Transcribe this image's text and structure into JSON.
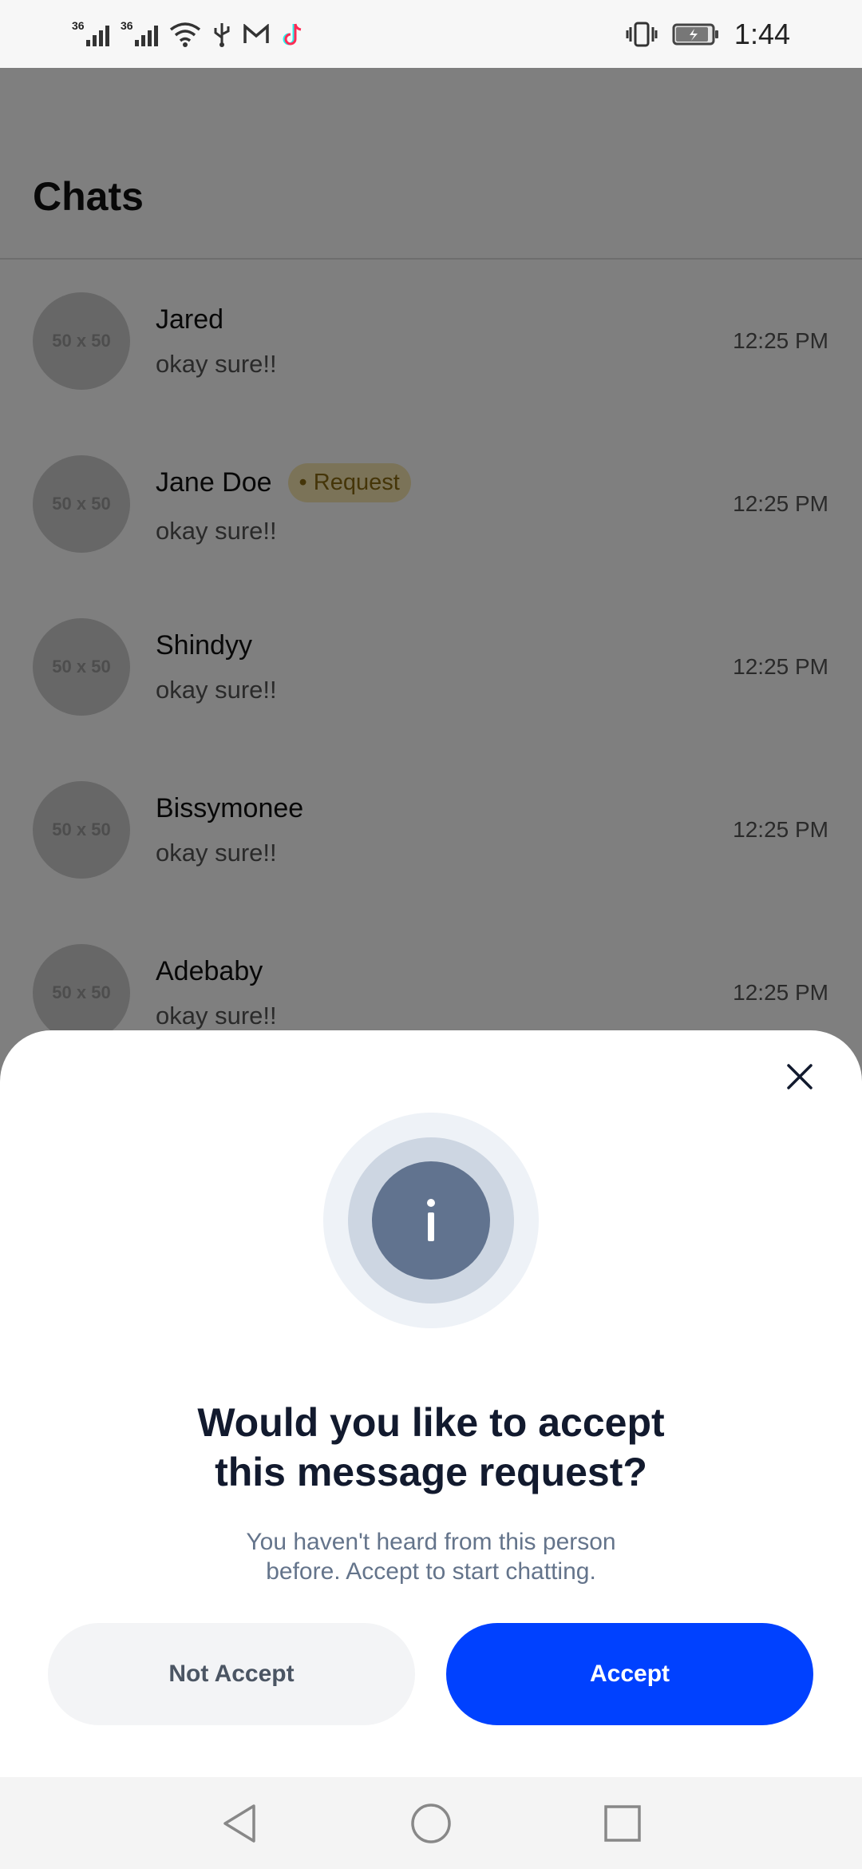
{
  "status_bar": {
    "network1": "36",
    "network2": "36",
    "time": "1:44",
    "icons": [
      "signal-icon",
      "signal-icon",
      "wifi-icon",
      "usb-icon",
      "gmail-icon",
      "tiktok-icon",
      "vibrate-icon",
      "battery-charging-icon"
    ]
  },
  "header": {
    "title": "Chats"
  },
  "chats": [
    {
      "avatar": "50 x 50",
      "name": "Jared",
      "message": "okay sure!!",
      "time": "12:25 PM"
    },
    {
      "avatar": "50 x 50",
      "name": "Jane Doe",
      "badge": "• Request",
      "message": "okay sure!!",
      "time": "12:25 PM"
    },
    {
      "avatar": "50 x 50",
      "name": "Shindyy",
      "message": "okay sure!!",
      "time": "12:25 PM"
    },
    {
      "avatar": "50 x 50",
      "name": "Bissymonee",
      "message": "okay sure!!",
      "time": "12:25 PM"
    },
    {
      "avatar": "50 x 50",
      "name": "Adebaby",
      "message": "okay sure!!",
      "time": "12:25 PM"
    }
  ],
  "modal": {
    "icon_letter": "i",
    "title": "Would you like to accept\nthis message request?",
    "subtitle": "You haven't heard from this person\nbefore. Accept to start chatting.",
    "not_accept_label": "Not Accept",
    "accept_label": "Accept"
  },
  "colors": {
    "accent": "#0041ff",
    "badge_bg": "#f6e6b0",
    "badge_text": "#8a6a10",
    "info_icon": "#61738f"
  },
  "nav": {
    "icons": [
      "back-icon",
      "home-icon",
      "recents-icon"
    ]
  }
}
